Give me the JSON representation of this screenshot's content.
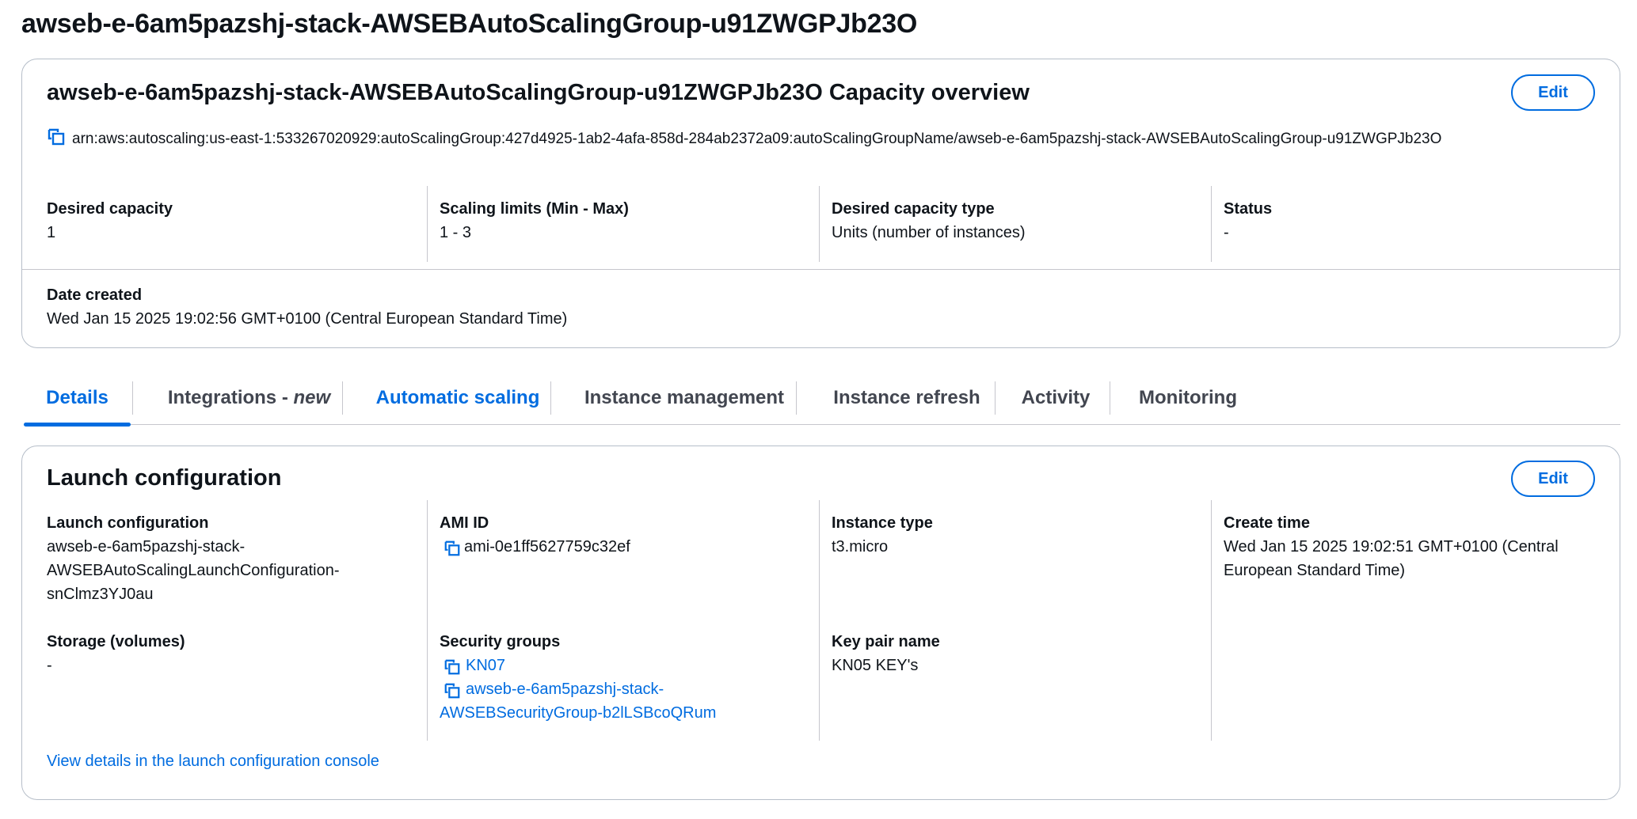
{
  "page_title": "awseb-e-6am5pazshj-stack-AWSEBAutoScalingGroup-u91ZWGPJb23O",
  "capacity": {
    "title": "awseb-e-6am5pazshj-stack-AWSEBAutoScalingGroup-u91ZWGPJb23O Capacity overview",
    "edit_label": "Edit",
    "arn": "arn:aws:autoscaling:us-east-1:533267020929:autoScalingGroup:427d4925-1ab2-4afa-858d-284ab2372a09:autoScalingGroupName/awseb-e-6am5pazshj-stack-AWSEBAutoScalingGroup-u91ZWGPJb23O",
    "desired_capacity": {
      "label": "Desired capacity",
      "value": "1"
    },
    "scaling_limits": {
      "label": "Scaling limits (Min - Max)",
      "value": "1 - 3"
    },
    "desired_capacity_type": {
      "label": "Desired capacity type",
      "value": "Units (number of instances)"
    },
    "status": {
      "label": "Status",
      "value": "-"
    },
    "date_created": {
      "label": "Date created",
      "value": "Wed Jan 15 2025 19:02:56 GMT+0100 (Central European Standard Time)"
    }
  },
  "tabs": [
    {
      "label": "Details",
      "active": true
    },
    {
      "label": "Integrations - ",
      "suffix": "new"
    },
    {
      "label": "Automatic scaling"
    },
    {
      "label": "Instance management"
    },
    {
      "label": "Instance refresh"
    },
    {
      "label": "Activity"
    },
    {
      "label": "Monitoring"
    }
  ],
  "launch": {
    "title": "Launch configuration",
    "edit_label": "Edit",
    "launch_configuration": {
      "label": "Launch configuration",
      "value_lines": [
        "awseb-e-6am5pazshj-stack-",
        "AWSEBAutoScalingLaunchConfiguration-",
        "snClmz3YJ0au"
      ]
    },
    "ami_id": {
      "label": "AMI ID",
      "value": "ami-0e1ff5627759c32ef"
    },
    "instance_type": {
      "label": "Instance type",
      "value": "t3.micro"
    },
    "create_time": {
      "label": "Create time",
      "value_lines": [
        "Wed Jan 15 2025 19:02:51 GMT+0100 (Central",
        "European Standard Time)"
      ]
    },
    "storage": {
      "label": "Storage (volumes)",
      "value": "-"
    },
    "security_groups": {
      "label": "Security groups",
      "items": [
        "KN07"
      ],
      "item2_lines": [
        "awseb-e-6am5pazshj-stack-",
        "AWSEBSecurityGroup-b2lLSBcoQRum"
      ]
    },
    "key_pair": {
      "label": "Key pair name",
      "value": "KN05 KEY's"
    },
    "view_details_link": "View details in the launch configuration console"
  },
  "icons": {
    "copy": "copy-icon"
  },
  "colors": {
    "link": "#006ce0",
    "text": "#0f141a",
    "border": "#b6bec9"
  }
}
